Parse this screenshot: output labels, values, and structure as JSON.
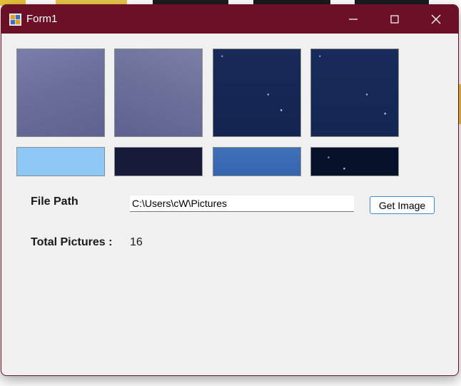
{
  "window": {
    "title": "Form1",
    "titlebar_color": "#6b1027"
  },
  "thumbnails": [
    {
      "name": "overcast-sky-1",
      "fill": "#6a6e98"
    },
    {
      "name": "overcast-sky-2",
      "fill": "#6b6f98"
    },
    {
      "name": "starry-night-1",
      "fill": "#142550"
    },
    {
      "name": "starry-night-2",
      "fill": "#152852"
    },
    {
      "name": "light-blue",
      "fill": "#8ec8f5"
    },
    {
      "name": "dark-navy",
      "fill": "#171a38"
    },
    {
      "name": "royal-blue",
      "fill": "#3868b0"
    },
    {
      "name": "deep-night",
      "fill": "#06112a"
    }
  ],
  "form": {
    "file_path_label": "File Path",
    "file_path_value": "C:\\Users\\cW\\Pictures",
    "get_image_label": "Get Image",
    "total_label": "Total Pictures :",
    "total_value": "16"
  }
}
